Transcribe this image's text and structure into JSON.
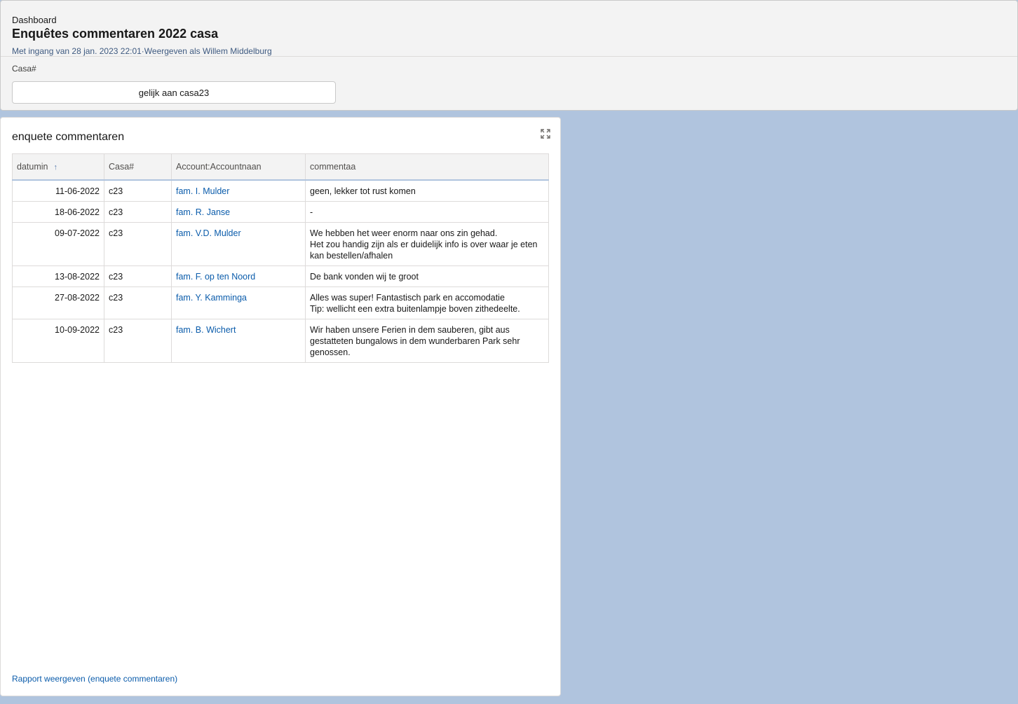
{
  "header": {
    "breadcrumb": "Dashboard",
    "title": "Enquêtes commentaren 2022 casa",
    "subtitle": "Met ingang van 28 jan. 2023 22:01·Weergeven als Willem Middelburg"
  },
  "filter": {
    "label": "Casa#",
    "value": "gelijk aan casa23"
  },
  "card": {
    "title": "enquete commentaren",
    "expand_icon": "expand-icon",
    "report_link": "Rapport weergeven (enquete commentaren)"
  },
  "table": {
    "columns": [
      "datumin",
      "Casa#",
      "Account:Accountnaan",
      "commentaa"
    ],
    "sort_icon": "↑",
    "rows": [
      {
        "date": "11-06-2022",
        "casa": "c23",
        "account": "fam. I. Mulder",
        "comment": [
          "geen, lekker tot rust komen"
        ]
      },
      {
        "date": "18-06-2022",
        "casa": "c23",
        "account": "fam. R. Janse",
        "comment": [
          "-"
        ]
      },
      {
        "date": "09-07-2022",
        "casa": "c23",
        "account": "fam. V.D. Mulder",
        "comment": [
          "We hebben het weer enorm naar ons zin gehad.",
          "Het zou handig zijn als er duidelijk info is over waar je eten kan bestellen/afhalen"
        ]
      },
      {
        "date": "13-08-2022",
        "casa": "c23",
        "account": "fam. F. op ten Noord",
        "comment": [
          "De bank vonden wij te groot"
        ]
      },
      {
        "date": "27-08-2022",
        "casa": "c23",
        "account": "fam. Y. Kamminga",
        "comment": [
          "Alles was super! Fantastisch park en accomodatie",
          "Tip: wellicht een extra buitenlampje boven zithedeelte."
        ]
      },
      {
        "date": "10-09-2022",
        "casa": "c23",
        "account": "fam. B. Wichert",
        "comment": [
          "Wir haben unsere Ferien in dem sauberen, gibt aus gestatteten bungalows in dem wunderbaren Park sehr genossen."
        ]
      }
    ]
  }
}
